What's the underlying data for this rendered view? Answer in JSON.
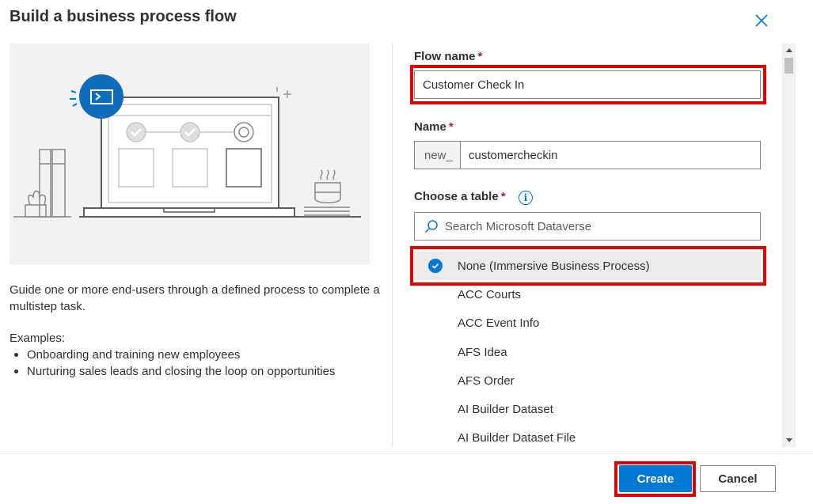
{
  "dialog": {
    "title": "Build a business process flow"
  },
  "left_panel": {
    "description": "Guide one or more end-users through a defined process to complete a multistep task.",
    "examples_heading": "Examples:",
    "examples": [
      "Onboarding and training new employees",
      "Nurturing sales leads and closing the loop on opportunities"
    ]
  },
  "form": {
    "flow_name_label": "Flow name",
    "flow_name_value": "Customer Check In",
    "name_label": "Name",
    "name_prefix": "new_",
    "name_value": "customercheckin",
    "table_label": "Choose a table",
    "required_marker": "*",
    "search_placeholder": "Search Microsoft Dataverse",
    "tables": [
      "None (Immersive Business Process)",
      "ACC Courts",
      "ACC Event Info",
      "AFS Idea",
      "AFS Order",
      "AI Builder Dataset",
      "AI Builder Dataset File"
    ],
    "selected_table": "None (Immersive Business Process)"
  },
  "footer": {
    "create_label": "Create",
    "cancel_label": "Cancel"
  },
  "colors": {
    "accent": "#0078d4",
    "highlight": "#e00000",
    "required": "#a4262c"
  },
  "icons": {
    "close": "close-icon",
    "info": "info-icon",
    "search": "search-icon",
    "check": "check-circle-icon",
    "power_automate": "power-automate-icon"
  }
}
